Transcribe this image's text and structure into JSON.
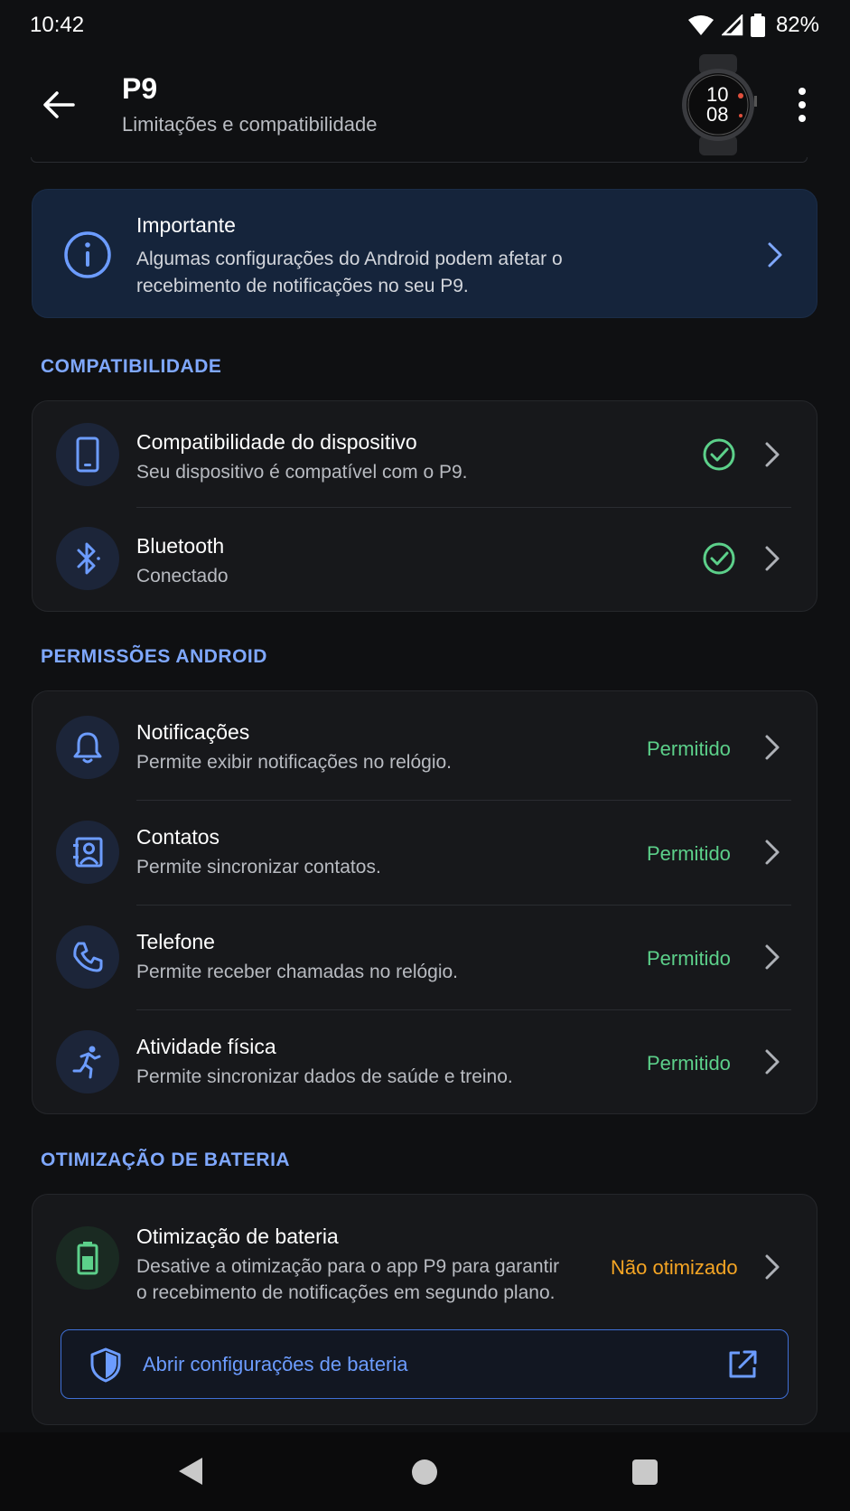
{
  "status_bar": {
    "time": "10:42",
    "battery": "82%"
  },
  "app_bar": {
    "title": "P9",
    "subtitle": "Limitações e compatibilidade",
    "watch_time_hour": "10",
    "watch_time_min": "08"
  },
  "banner": {
    "title": "Importante",
    "text": "Algumas configurações do Android podem afetar o recebimento de notificações no seu P9."
  },
  "sections": {
    "compat": "COMPATIBILIDADE",
    "permissions": "PERMISSÕES ANDROID",
    "battery": "OTIMIZAÇÃO DE BATERIA"
  },
  "compat_items": [
    {
      "title": "Compatibilidade do dispositivo",
      "subtitle": "Seu dispositivo é compatível com o P9.",
      "icon": "phone-icon"
    },
    {
      "title": "Bluetooth",
      "subtitle": "Conectado",
      "icon": "bluetooth-icon"
    }
  ],
  "permission_items": [
    {
      "title": "Notificações",
      "subtitle": "Permite exibir notificações no relógio.",
      "status": "Permitido",
      "icon": "bell-icon"
    },
    {
      "title": "Contatos",
      "subtitle": "Permite sincronizar contatos.",
      "status": "Permitido",
      "icon": "contact-icon"
    },
    {
      "title": "Telefone",
      "subtitle": "Permite receber chamadas no relógio.",
      "status": "Permitido",
      "icon": "phone-call-icon"
    },
    {
      "title": "Atividade física",
      "subtitle": "Permite sincronizar dados de saúde e treino.",
      "status": "Permitido",
      "icon": "running-icon"
    }
  ],
  "battery_item": {
    "title": "Otimização de bateria",
    "subtitle_line1": "Desative a otimização para o app P9 para garantir",
    "subtitle_line2": "o recebimento de notificações em segundo plano.",
    "status": "Não otimizado",
    "button_label": "Abrir configurações de bateria"
  },
  "colors": {
    "accent": "#7fa8ff",
    "allowed": "#5cd08a",
    "warning": "#f5a524",
    "background": "#0f1012",
    "card": "#17181b"
  }
}
